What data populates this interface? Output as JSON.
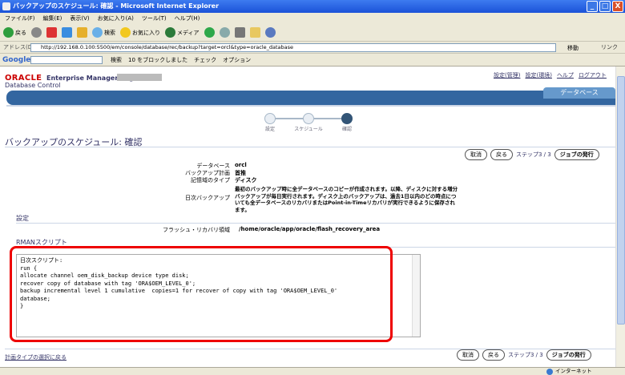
{
  "window": {
    "title": "バックアップのスケジュール: 確認 - Microsoft Internet Explorer",
    "minimize": "_",
    "maximize": "□",
    "close": "X"
  },
  "menu": [
    "ファイル(F)",
    "編集(E)",
    "表示(V)",
    "お気に入り(A)",
    "ツール(T)",
    "ヘルプ(H)"
  ],
  "toolbar": {
    "back": "戻る",
    "search": "検索",
    "favorites": "お気に入り",
    "media": "メディア"
  },
  "address": {
    "label": "アドレス(D)",
    "url": "http://192.168.0.100:5500/em/console/database/rec/backup?target=orcl&type=oracle_database",
    "go": "移動",
    "links": "リンク"
  },
  "google": {
    "logo": "Google",
    "search": "検索",
    "blocked": "10 をブロックしました",
    "check": "チェック",
    "options": "オプション"
  },
  "header": {
    "oracle": "ORACLE",
    "product": "Enterprise Manager 10g",
    "subtitle": "Database Control",
    "links": [
      "設定(管理)",
      "設定(環境)",
      "ヘルプ",
      "ログアウト"
    ],
    "tab": "データベース"
  },
  "train": {
    "steps": [
      "設定",
      "スケジュール",
      "確認"
    ]
  },
  "page": {
    "title": "バックアップのスケジュール: 確認"
  },
  "actions": {
    "cancel": "取消",
    "back": "戻る",
    "step": "ステップ3 / 3",
    "submit": "ジョブの発行"
  },
  "summary": {
    "db_label": "データベース",
    "db_value": "orcl",
    "plan_label": "バックアップ計画",
    "plan_value": "首推",
    "media_label": "記憶域のタイプ",
    "media_value": "ディスク",
    "daily_label": "日次バックアップ",
    "daily_value": "最初のバックアップ時に全データベースのコピーが作成されます。以降、ディスクに対する増分バックアップが毎日実行されます。ディスク上のバックアップは、過去1日以内のどの時点についても全データベースのリカバリまたはPoint-in-Timeリカバリが実行できるように保存されます。"
  },
  "settings": {
    "section": "設定",
    "fra_label": "フラッシュ・リカバリ領域",
    "fra_value": "/home/oracle/app/oracle/flash_recovery_area"
  },
  "rman": {
    "section": "RMANスクリプト",
    "script": "日次スクリプト:\nrun {\nallocate channel oem_disk_backup device type disk;\nrecover copy of database with tag 'ORA$OEM_LEVEL_0';\nbackup incremental level 1 cumulative  copies=1 for recover of copy with tag 'ORA$OEM_LEVEL_0'\ndatabase;\n}"
  },
  "footer": {
    "link": "計画タイプの選択に戻る"
  },
  "status": {
    "zone": "インターネット"
  },
  "colors": {
    "title_blue": "#1b52d8",
    "oracle_red": "#cc0000",
    "highlight": "#ee0000"
  }
}
